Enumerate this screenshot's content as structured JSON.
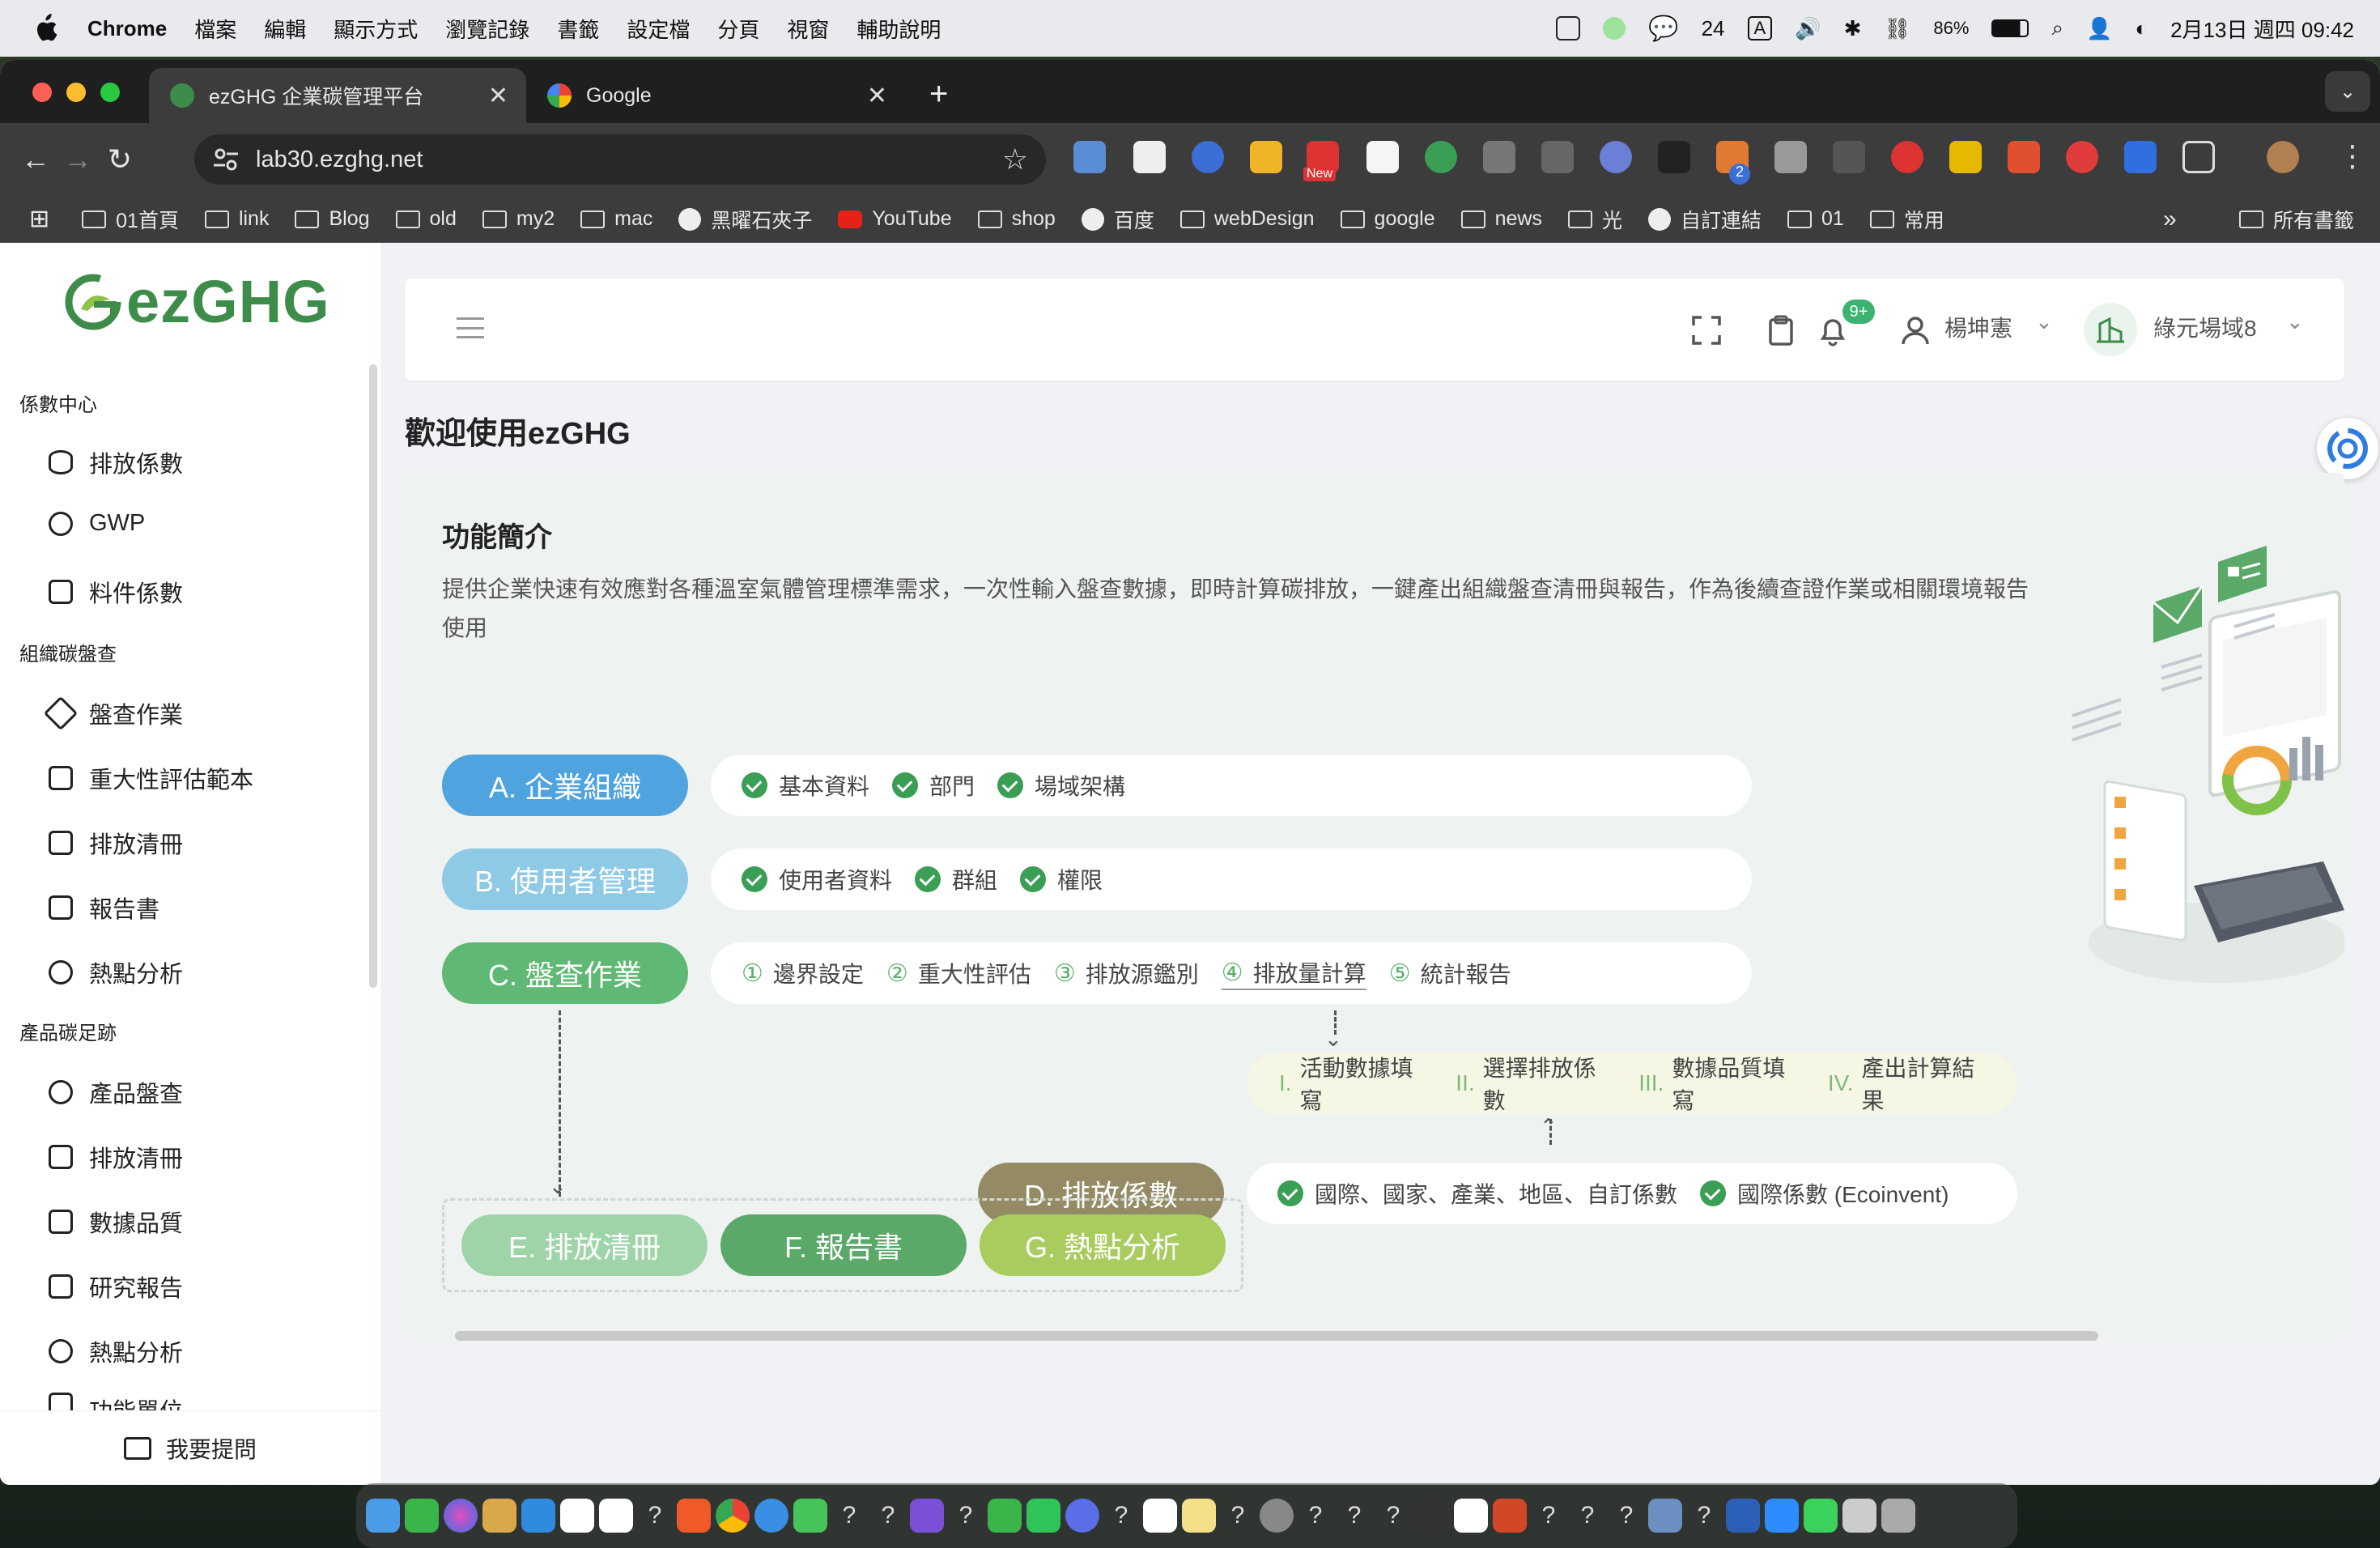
{
  "menubar": {
    "app": "Chrome",
    "items": [
      "檔案",
      "編輯",
      "顯示方式",
      "瀏覽記錄",
      "書籤",
      "設定檔",
      "分頁",
      "視窗",
      "輔助說明"
    ],
    "wechat_count": "24",
    "input_mode": "A",
    "battery": "86%",
    "datetime": "2月13日 週四 09:42"
  },
  "browser": {
    "tabs": [
      {
        "title": "ezGHG 企業碳管理平台",
        "active": true
      },
      {
        "title": "Google",
        "active": false
      }
    ],
    "url": "lab30.ezghg.net",
    "ext_badge_new": "New",
    "ext_badge_count": "2",
    "bookmarks": [
      {
        "label": "01首頁",
        "icon": "folder-icon"
      },
      {
        "label": "link",
        "icon": "folder-icon"
      },
      {
        "label": "Blog",
        "icon": "folder-icon"
      },
      {
        "label": "old",
        "icon": "folder-icon"
      },
      {
        "label": "my2",
        "icon": "folder-icon"
      },
      {
        "label": "mac",
        "icon": "folder-icon"
      },
      {
        "label": "黑曜石夾子",
        "icon": "globe-icon"
      },
      {
        "label": "YouTube",
        "icon": "youtube-icon"
      },
      {
        "label": "shop",
        "icon": "folder-icon"
      },
      {
        "label": "百度",
        "icon": "globe-icon"
      },
      {
        "label": "webDesign",
        "icon": "folder-icon"
      },
      {
        "label": "google",
        "icon": "folder-icon"
      },
      {
        "label": "news",
        "icon": "folder-icon"
      },
      {
        "label": "光",
        "icon": "folder-icon"
      },
      {
        "label": "自訂連結",
        "icon": "globe-icon"
      },
      {
        "label": "01",
        "icon": "folder-icon"
      },
      {
        "label": "常用",
        "icon": "folder-icon"
      }
    ],
    "all_bookmarks": "所有書籤",
    "more": "»"
  },
  "sidebar": {
    "logo_text": "ezGHG",
    "groups": [
      {
        "title": "係數中心",
        "items": [
          "排放係數",
          "GWP",
          "料件係數"
        ]
      },
      {
        "title": "組織碳盤查",
        "items": [
          "盤查作業",
          "重大性評估範本",
          "排放清冊",
          "報告書",
          "熱點分析"
        ]
      },
      {
        "title": "產品碳足跡",
        "items": [
          "產品盤查",
          "排放清冊",
          "數據品質",
          "研究報告",
          "熱點分析",
          "功能單位"
        ]
      }
    ],
    "feedback": "我要提問"
  },
  "header": {
    "notification_badge": "9+",
    "user": "楊坤憲",
    "site": "綠元場域8"
  },
  "page": {
    "title": "歡迎使用ezGHG",
    "intro_title": "功能簡介",
    "intro_text": "提供企業快速有效應對各種溫室氣體管理標準需求，一次性輸入盤查數據，即時計算碳排放，一鍵產出組織盤查清冊與報告，作為後續查證作業或相關環境報告使用",
    "modules": {
      "a": {
        "label": "A. 企業組織",
        "color": "#4fa3de",
        "items": [
          "基本資料",
          "部門",
          "場域架構"
        ]
      },
      "b": {
        "label": "B. 使用者管理",
        "color": "#8ec9e6",
        "items": [
          "使用者資料",
          "群組",
          "權限"
        ]
      },
      "c": {
        "label": "C. 盤查作業",
        "color": "#5fb873",
        "steps": [
          {
            "num": "①",
            "label": "邊界設定"
          },
          {
            "num": "②",
            "label": "重大性評估"
          },
          {
            "num": "③",
            "label": "排放源鑑別"
          },
          {
            "num": "④",
            "label": "排放量計算"
          },
          {
            "num": "⑤",
            "label": "統計報告"
          }
        ]
      },
      "calc_steps": [
        {
          "num": "I.",
          "label": "活動數據填寫"
        },
        {
          "num": "II.",
          "label": "選擇排放係數"
        },
        {
          "num": "III.",
          "label": "數據品質填寫"
        },
        {
          "num": "IV.",
          "label": "產出計算結果"
        }
      ],
      "d": {
        "label": "D. 排放係數",
        "color": "#948b65",
        "items": [
          "國際、國家、產業、地區、自訂係數",
          "國際係數 (Ecoinvent)"
        ]
      },
      "e": {
        "label": "E. 排放清冊",
        "color": "#9fd4a9"
      },
      "f": {
        "label": "F. 報告書",
        "color": "#5aa968"
      },
      "g": {
        "label": "G. 熱點分析",
        "color": "#a9cc5e"
      }
    }
  }
}
